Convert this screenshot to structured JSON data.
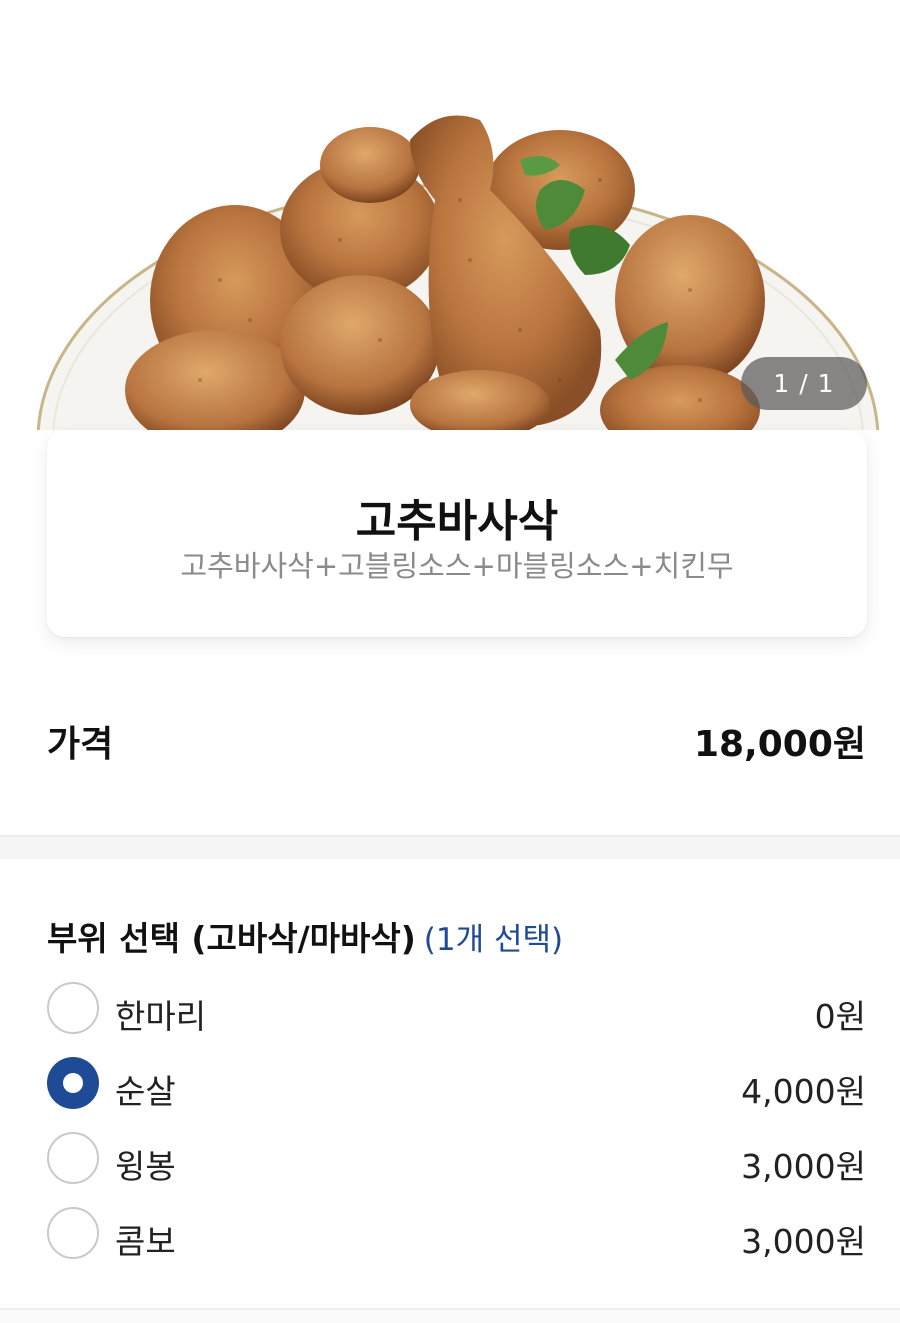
{
  "hero": {
    "image_alt": "fried chicken on a plate",
    "pager": "1 / 1"
  },
  "product": {
    "title": "고추바사삭",
    "description": "고추바사삭+고블링소스+마블링소스+치킨무"
  },
  "price": {
    "label": "가격",
    "value": "18,000원"
  },
  "options": {
    "header": "부위 선택 (고바삭/마바삭)",
    "hint": "(1개 선택)",
    "items": [
      {
        "label": "한마리",
        "price": "0원",
        "selected": false
      },
      {
        "label": "순살",
        "price": "4,000원",
        "selected": true
      },
      {
        "label": "윙봉",
        "price": "3,000원",
        "selected": false
      },
      {
        "label": "콤보",
        "price": "3,000원",
        "selected": false
      }
    ]
  },
  "colors": {
    "accent": "#1f4a96",
    "muted_text": "#8a8a8a",
    "band": "#f5f5f5"
  }
}
